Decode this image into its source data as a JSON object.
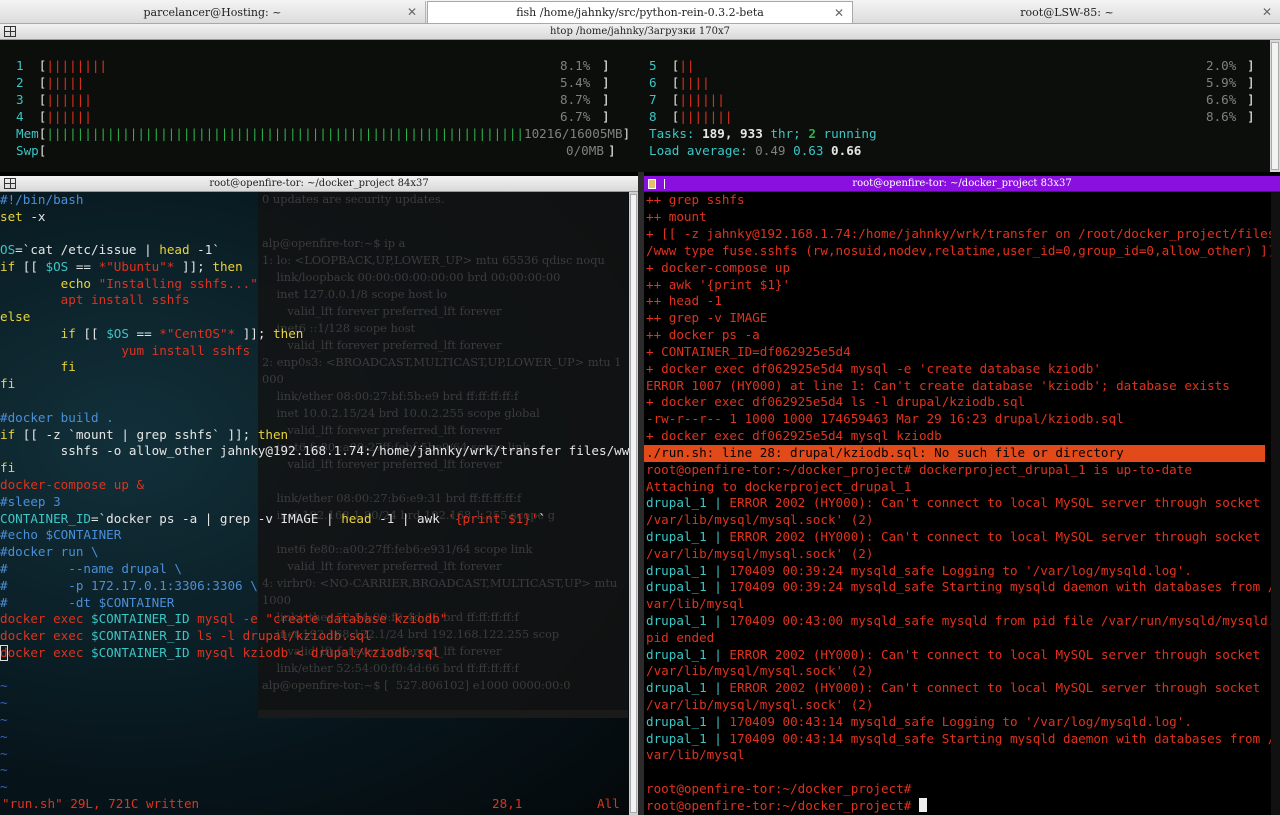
{
  "tabs": [
    {
      "label": "parcelancer@Hosting: ~",
      "active": false
    },
    {
      "label": "fish  /home/jahnky/src/python-rein-0.3.2-beta",
      "active": true
    },
    {
      "label": "root@LSW-85: ~",
      "active": false
    }
  ],
  "htop": {
    "title": "htop  /home/jahnky/Загрузки 170x7",
    "cpus_left": [
      {
        "n": "1",
        "bar": "||||||||",
        "pct": "8.1%"
      },
      {
        "n": "2",
        "bar": "|||||",
        "pct": "5.4%"
      },
      {
        "n": "3",
        "bar": "||||||",
        "pct": "8.7%"
      },
      {
        "n": "4",
        "bar": "||||||",
        "pct": "6.7%"
      }
    ],
    "cpus_right": [
      {
        "n": "5",
        "bar": "||",
        "pct": "2.0%"
      },
      {
        "n": "6",
        "bar": "||||",
        "pct": "5.9%"
      },
      {
        "n": "7",
        "bar": "||||||",
        "pct": "6.6%"
      },
      {
        "n": "8",
        "bar": "|||||||",
        "pct": "8.6%"
      }
    ],
    "mem_label": "Mem",
    "mem_value": "10216/16005MB",
    "swp_label": "Swp",
    "swp_value": "0/0MB",
    "tasks_label": "Tasks:",
    "tasks": "189,",
    "thr": "933",
    "thr_label": "thr;",
    "running": "2",
    "running_label": "running",
    "load_label": "Load average:",
    "load1": "0.49",
    "load5": "0.63",
    "load15": "0.66"
  },
  "vim": {
    "title": "root@openfire-tor: ~/docker_project 84x37",
    "status_file": "\"run.sh\" 29L, 721C written",
    "status_pos": "28,1",
    "status_all": "All"
  },
  "fish": {
    "title": "root@openfire-tor: ~/docker_project 83x37"
  }
}
